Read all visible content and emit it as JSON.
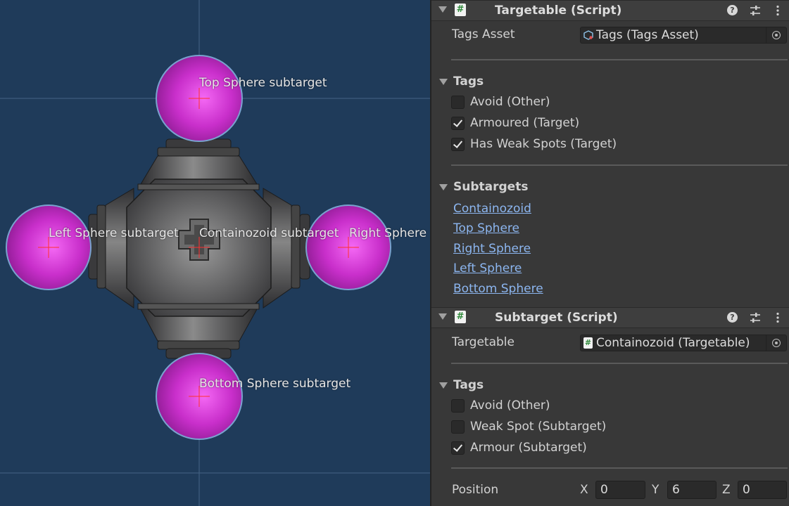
{
  "scene": {
    "labels": {
      "top": "Top Sphere subtarget",
      "left": "Left Sphere subtarget",
      "center": "Containozoid subtarget",
      "right": "Right Sphere",
      "bottom": "Bottom Sphere subtarget"
    },
    "colors": {
      "background": "#1f3b5a",
      "sphere": "#c531c9",
      "body": "#4a4a4a"
    }
  },
  "targetable_component": {
    "title": "Targetable (Script)",
    "tags_asset_label": "Tags Asset",
    "tags_asset_value": "Tags (Tags Asset)",
    "tags_section": "Tags",
    "tags": [
      {
        "label": "Avoid (Other)",
        "checked": false
      },
      {
        "label": "Armoured (Target)",
        "checked": true
      },
      {
        "label": "Has Weak Spots (Target)",
        "checked": true
      }
    ],
    "subtargets_section": "Subtargets",
    "subtargets": [
      "Containozoid",
      "Top Sphere",
      "Right Sphere",
      "Left Sphere",
      "Bottom Sphere"
    ]
  },
  "subtarget_component": {
    "title": "Subtarget (Script)",
    "targetable_label": "Targetable",
    "targetable_value": "Containozoid (Targetable)",
    "tags_section": "Tags",
    "tags": [
      {
        "label": "Avoid (Other)",
        "checked": false
      },
      {
        "label": "Weak Spot (Subtarget)",
        "checked": false
      },
      {
        "label": "Armour (Subtarget)",
        "checked": true
      }
    ],
    "position_label": "Position",
    "position": {
      "x_label": "X",
      "x": "0",
      "y_label": "Y",
      "y": "6",
      "z_label": "Z",
      "z": "0"
    }
  },
  "icons": [
    "script-icon",
    "help-icon",
    "preset-icon",
    "kebab-menu-icon",
    "object-picker-icon",
    "tags-asset-icon",
    "checkmark-icon",
    "fold-arrow-icon"
  ]
}
